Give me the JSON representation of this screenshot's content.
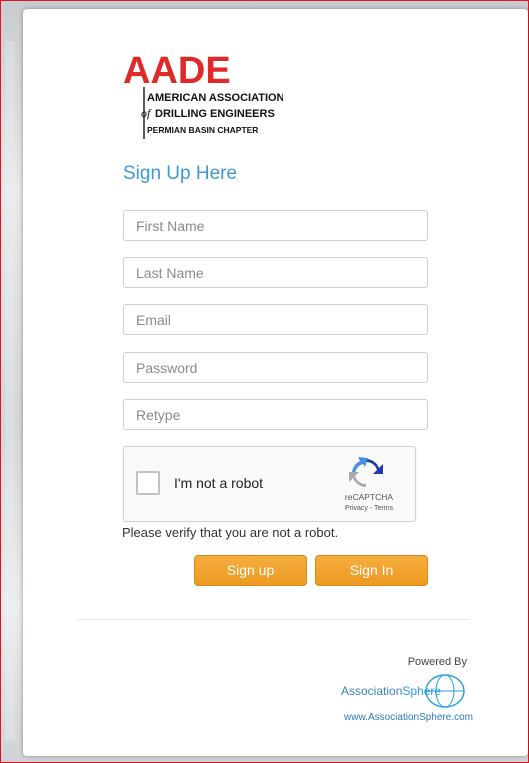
{
  "logo": {
    "mark": "AADE",
    "line1": "AMERICAN ASSOCIATION",
    "line2_prefix": "of",
    "line2": "DRILLING ENGINEERS",
    "line3": "PERMIAN BASIN CHAPTER",
    "accent_color": "#e02a2a"
  },
  "form": {
    "title": "Sign Up Here",
    "first_name_placeholder": "First Name",
    "last_name_placeholder": "Last Name",
    "email_placeholder": "Email",
    "password_placeholder": "Password",
    "retype_placeholder": "Retype",
    "captcha": {
      "checkbox_label": "I'm not a robot",
      "brand": "reCAPTCHA",
      "privacy": "Privacy",
      "separator": " - ",
      "terms": "Terms"
    },
    "verify_message": "Please verify that you are not a robot.",
    "signup_label": "Sign up",
    "signin_label": "Sign In"
  },
  "footer": {
    "powered_by": "Powered By",
    "brand_prefix": "Association",
    "brand_suffix": "Sphere",
    "url": "www.AssociationSphere.com"
  },
  "colors": {
    "title": "#3d9ad6",
    "button": "#ec9a22",
    "border_frame": "#e0141e"
  },
  "icons": [
    "recaptcha-logo-icon",
    "globe-icon"
  ]
}
